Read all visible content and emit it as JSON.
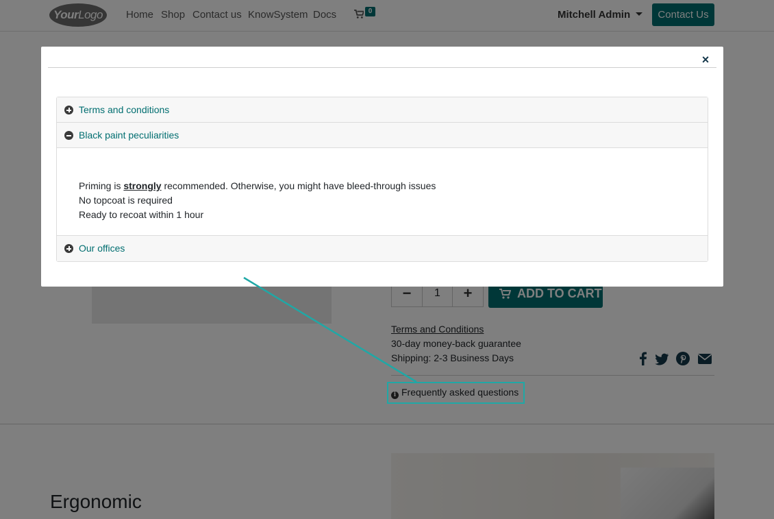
{
  "navbar": {
    "logo_text_bold": "Your",
    "logo_text_rest": "Logo",
    "links": [
      "Home",
      "Shop",
      "Contact us",
      "KnowSystem",
      "Docs"
    ],
    "cart_count": "0",
    "user_name": "Mitchell Admin",
    "cta_label": "Contact Us"
  },
  "product": {
    "quantity": "1",
    "minus_label": "−",
    "plus_label": "+",
    "add_to_cart_label": "ADD TO CART",
    "terms_link": "Terms and Conditions",
    "guarantee": "30-day money-back guarantee",
    "shipping": "Shipping: 2-3 Business Days",
    "faq_label": "Frequently asked questions",
    "share_icons": [
      "facebook-icon",
      "twitter-icon",
      "pinterest-icon",
      "email-icon"
    ]
  },
  "feature": {
    "heading": "Ergonomic"
  },
  "modal": {
    "close_label": "×",
    "accordion": [
      {
        "label": "Terms and conditions",
        "expanded": false
      },
      {
        "label": "Black paint peculiarities",
        "expanded": true
      },
      {
        "label": "Our offices",
        "expanded": false
      }
    ],
    "body": {
      "line1_before": "Priming is ",
      "line1_strong": "strongly",
      "line1_after": " recommended. Otherwise, you might have bleed-through issues",
      "line2": "No topcoat is required",
      "line3": "Ready to recoat within 1 hour"
    }
  },
  "colors": {
    "brand": "#016e70",
    "highlight": "#1fa8a6"
  }
}
